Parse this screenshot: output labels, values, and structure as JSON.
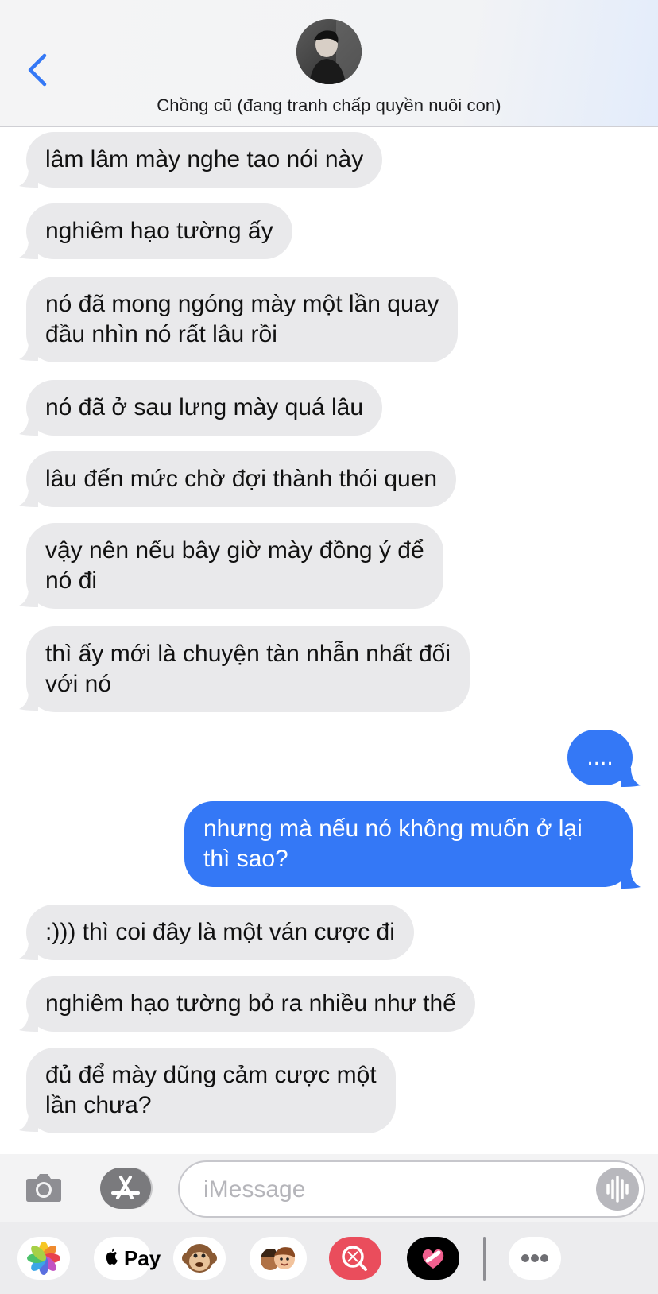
{
  "header": {
    "contact_name": "Chồng cũ (đang tranh chấp quyền nuôi con)",
    "back_icon": "chevron-left-icon"
  },
  "messages": [
    {
      "direction": "incoming",
      "text": "lâm lâm mày nghe tao nói này"
    },
    {
      "direction": "incoming",
      "text": "nghiêm hạo tường ấy"
    },
    {
      "direction": "incoming",
      "text": "nó đã mong ngóng mày một lần quay\nđầu nhìn nó rất lâu rồi"
    },
    {
      "direction": "incoming",
      "text": "nó đã ở sau lưng mày quá lâu"
    },
    {
      "direction": "incoming",
      "text": "lâu đến mức chờ đợi thành thói quen"
    },
    {
      "direction": "incoming",
      "text": "vậy nên nếu bây giờ mày đồng ý để\nnó đi"
    },
    {
      "direction": "incoming",
      "text": "thì ấy mới là chuyện tàn nhẫn nhất đối\nvới nó"
    },
    {
      "direction": "outgoing",
      "text": "...."
    },
    {
      "direction": "outgoing",
      "text": "nhưng mà nếu nó không muốn ở lại\nthì sao?"
    },
    {
      "direction": "incoming",
      "text": ":))) thì coi đây là một ván cược đi"
    },
    {
      "direction": "incoming",
      "text": "nghiêm hạo tường bỏ ra nhiều như thế"
    },
    {
      "direction": "incoming",
      "text": "đủ để mày dũng cảm cược một\nlần chưa?"
    }
  ],
  "compose": {
    "placeholder": "iMessage",
    "camera_icon": "camera-icon",
    "appstore_icon": "app-store-icon",
    "audio_icon": "audio-waveform-icon"
  },
  "drawer": {
    "apps": [
      {
        "name": "photos-icon"
      },
      {
        "name": "apple-pay",
        "label": "Pay"
      },
      {
        "name": "animoji-monkey-icon"
      },
      {
        "name": "memoji-icon"
      },
      {
        "name": "web-search-icon"
      },
      {
        "name": "digital-touch-icon"
      },
      {
        "name": "more-apps-icon"
      }
    ]
  },
  "colors": {
    "incoming_bubble": "#e9e9eb",
    "outgoing_bubble": "#3478f6",
    "accent": "#3478f6"
  }
}
